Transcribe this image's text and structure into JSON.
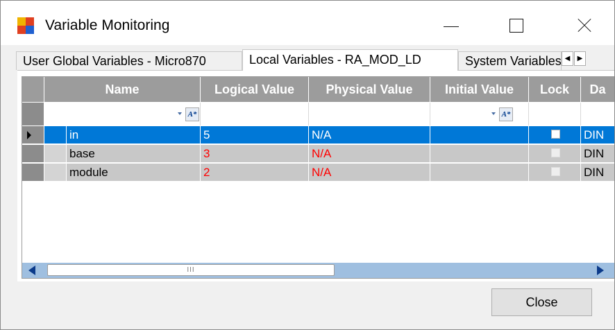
{
  "window": {
    "title": "Variable Monitoring",
    "icon": "app-window-icon"
  },
  "tabs": [
    {
      "label": "User Global Variables - Micro870",
      "active": false
    },
    {
      "label": "Local Variables - RA_MOD_LD",
      "active": true
    },
    {
      "label": "System Variables",
      "active": false
    }
  ],
  "tab_scroll": {
    "left": "◀",
    "right": "▶"
  },
  "grid": {
    "columns": [
      "Name",
      "Logical Value",
      "Physical Value",
      "Initial Value",
      "Lock",
      "Da"
    ],
    "filter_glyph": "A*",
    "rows": [
      {
        "name": "in",
        "logical": "5",
        "physical": "N/A",
        "initial": "",
        "lock": false,
        "data_type": "DIN",
        "selected": true
      },
      {
        "name": "base",
        "logical": "3",
        "physical": "N/A",
        "initial": "",
        "lock": false,
        "data_type": "DIN",
        "selected": false
      },
      {
        "name": "module",
        "logical": "2",
        "physical": "N/A",
        "initial": "",
        "lock": false,
        "data_type": "DIN",
        "selected": false
      }
    ],
    "hscroll_grip": "III"
  },
  "buttons": {
    "close": "Close"
  },
  "colors": {
    "selection": "#0078d7",
    "header": "#9c9c9c",
    "value_red": "#ff0000",
    "scroll_track": "#9fbfe0"
  }
}
